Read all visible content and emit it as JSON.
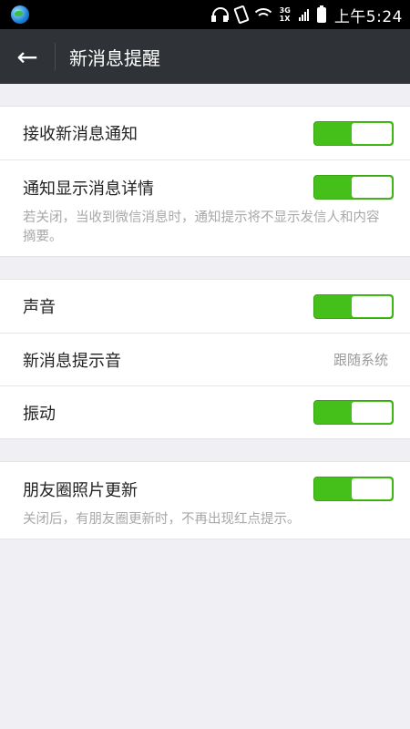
{
  "status_bar": {
    "time": "上午5:24",
    "network_top": "3G",
    "network_bottom": "1X",
    "icons": [
      "globe-icon",
      "headphones-icon",
      "vibrate-icon",
      "wifi-icon",
      "signal-icon",
      "battery-icon"
    ]
  },
  "header": {
    "back_icon": "←",
    "title": "新消息提醒"
  },
  "groups": [
    {
      "rows": [
        {
          "label": "接收新消息通知",
          "toggle": true,
          "on": true
        },
        {
          "label": "通知显示消息详情",
          "toggle": true,
          "on": true,
          "hint": "若关闭，当收到微信消息时，通知提示将不显示发信人和内容摘要。"
        }
      ]
    },
    {
      "rows": [
        {
          "label": "声音",
          "toggle": true,
          "on": true
        },
        {
          "label": "新消息提示音",
          "value": "跟随系统"
        },
        {
          "label": "振动",
          "toggle": true,
          "on": true
        }
      ]
    },
    {
      "rows": [
        {
          "label": "朋友圈照片更新",
          "toggle": true,
          "on": true,
          "hint": "关闭后，有朋友圈更新时，不再出现红点提示。"
        }
      ]
    }
  ],
  "colors": {
    "toggle_on": "#45c01a",
    "header_bg": "#2f3236",
    "page_bg": "#efeff4"
  }
}
